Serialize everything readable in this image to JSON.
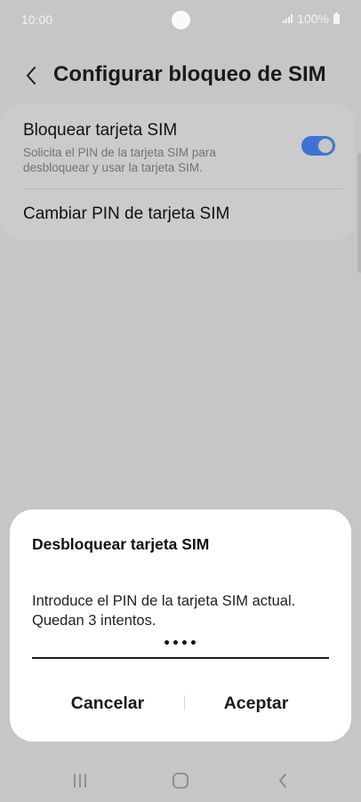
{
  "status_bar": {
    "time": "10:00",
    "battery": "100%"
  },
  "header": {
    "title": "Configurar bloqueo de SIM"
  },
  "settings": {
    "lock_sim": {
      "title": "Bloquear tarjeta SIM",
      "subtitle": "Solicita el PIN de la tarjeta SIM para desbloquear y usar la tarjeta SIM.",
      "enabled": true
    },
    "change_pin": {
      "title": "Cambiar PIN de tarjeta SIM"
    }
  },
  "dialog": {
    "title": "Desbloquear tarjeta SIM",
    "message": "Introduce el PIN de la tarjeta SIM actual. Quedan 3 intentos.",
    "pin_value": "••••",
    "cancel_label": "Cancelar",
    "accept_label": "Aceptar"
  },
  "colors": {
    "accent": "#3c74d3",
    "background_dimmed": "#c6c6c6",
    "dialog_background": "#ffffff"
  },
  "icons": {
    "back": "chevron-left-icon",
    "recents": "recents-icon",
    "home": "home-icon",
    "nav_back": "nav-back-icon"
  }
}
